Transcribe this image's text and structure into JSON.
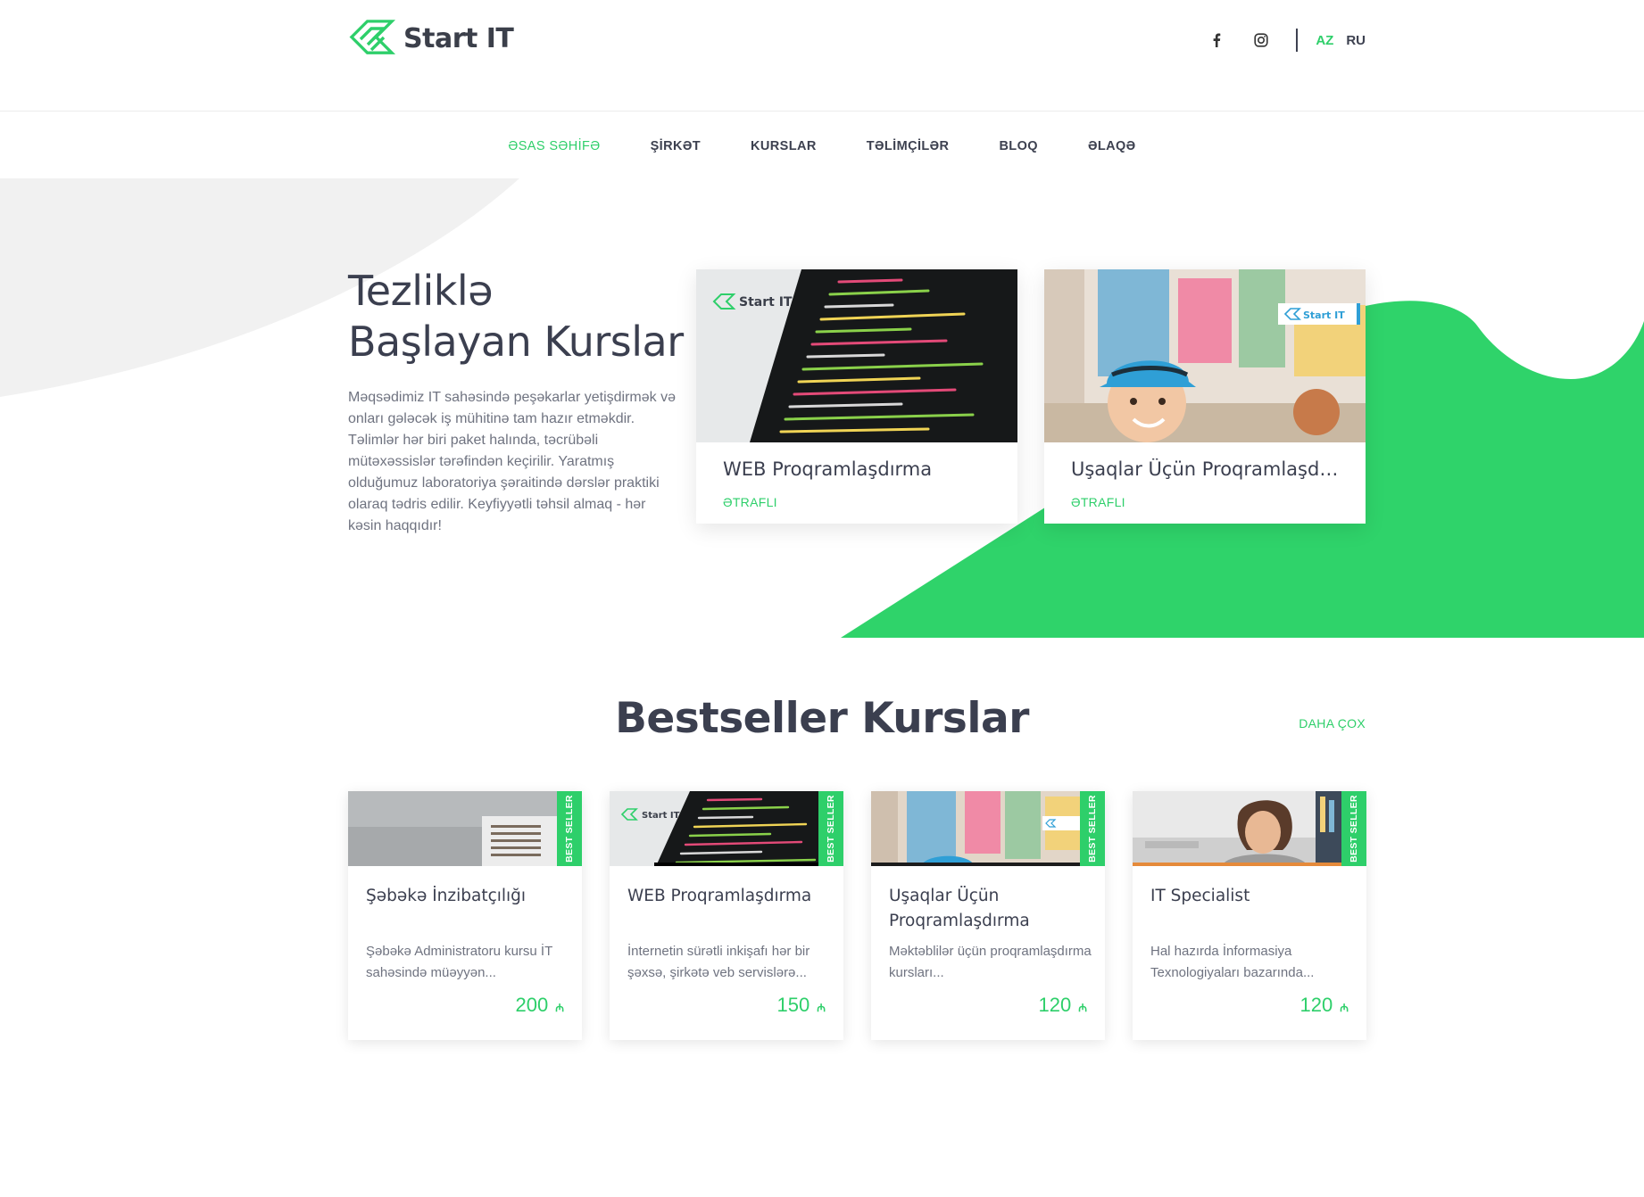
{
  "brand": {
    "name": "Start IT",
    "accent": "#2ecf6a"
  },
  "header": {
    "social": [
      "facebook-icon",
      "instagram-icon"
    ],
    "languages": [
      {
        "label": "AZ",
        "active": true
      },
      {
        "label": "RU",
        "active": false
      }
    ]
  },
  "nav": [
    {
      "label": "ƏSAS SƏHİFƏ",
      "active": true
    },
    {
      "label": "ŞİRKƏT",
      "active": false
    },
    {
      "label": "KURSLAR",
      "active": false
    },
    {
      "label": "TƏLİMÇİLƏR",
      "active": false
    },
    {
      "label": "BLOQ",
      "active": false
    },
    {
      "label": "ƏLAQƏ",
      "active": false
    }
  ],
  "hero": {
    "title_line1": "Tezliklə",
    "title_line2": "Başlayan Kurslar",
    "description": "Məqsədimiz IT sahəsində peşəkarlar yetişdirmək və onları gələcək iş mühitinə tam hazır etməkdir. Təlimlər hər biri paket halında, təcrübəli mütəxəssislər tərəfindən keçirilir. Yaratmış olduğumuz laboratoriya şəraitində dərslər praktiki olaraq tədris edilir. Keyfiyyətli təhsil almaq - hər kəsin haqqıdır!",
    "cards": [
      {
        "title": "WEB Proqramlaşdırma",
        "link": "ƏTRAFLI",
        "image_logo": "Start IT"
      },
      {
        "title": "Uşaqlar Üçün Proqramlaşdırma",
        "link": "ƏTRAFLI",
        "image_logo": "Start IT"
      }
    ]
  },
  "bestseller": {
    "title": "Bestseller Kurslar",
    "more": "DAHA ÇOX",
    "ribbon": "BEST SELLER",
    "currency": "₼",
    "courses": [
      {
        "name": "Şəbəkə İnzibatçılığı",
        "desc": "Şəbəkə Administratoru kursu İT sahəsində müəyyən...",
        "price": "200"
      },
      {
        "name": "WEB Proqramlaşdırma",
        "desc": "İnternetin sürətli inkişafı hər bir şəxsə, şirkətə veb servislərə...",
        "price": "150"
      },
      {
        "name": "Uşaqlar Üçün Proqramlaşdırma",
        "desc": "Məktəblilər üçün proqramlaşdırma kursları...",
        "price": "120"
      },
      {
        "name": "IT Specialist",
        "desc": "Hal hazırda İnformasiya Texnologiyaları bazarında...",
        "price": "120"
      }
    ]
  }
}
